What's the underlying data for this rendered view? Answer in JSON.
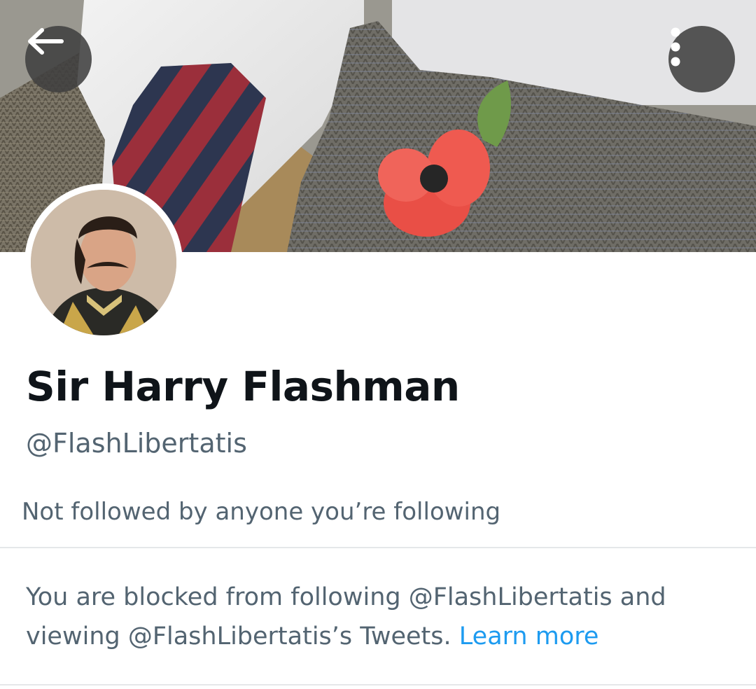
{
  "header": {
    "back_icon": "arrow-left-icon",
    "more_icon": "more-vertical-icon"
  },
  "profile": {
    "display_name": "Sir Harry Flashman",
    "handle": "@FlashLibertatis",
    "followers_context": "Not followed by anyone you’re following"
  },
  "block_notice": {
    "text": "You are blocked from following @FlashLibertatis and viewing @FlashLibertatis’s Tweets.",
    "link_label": "Learn more",
    "link_color": "#1d9bf0"
  },
  "colors": {
    "name": "#0f1419",
    "secondary_text": "#536471",
    "divider": "#e5e7e9"
  }
}
